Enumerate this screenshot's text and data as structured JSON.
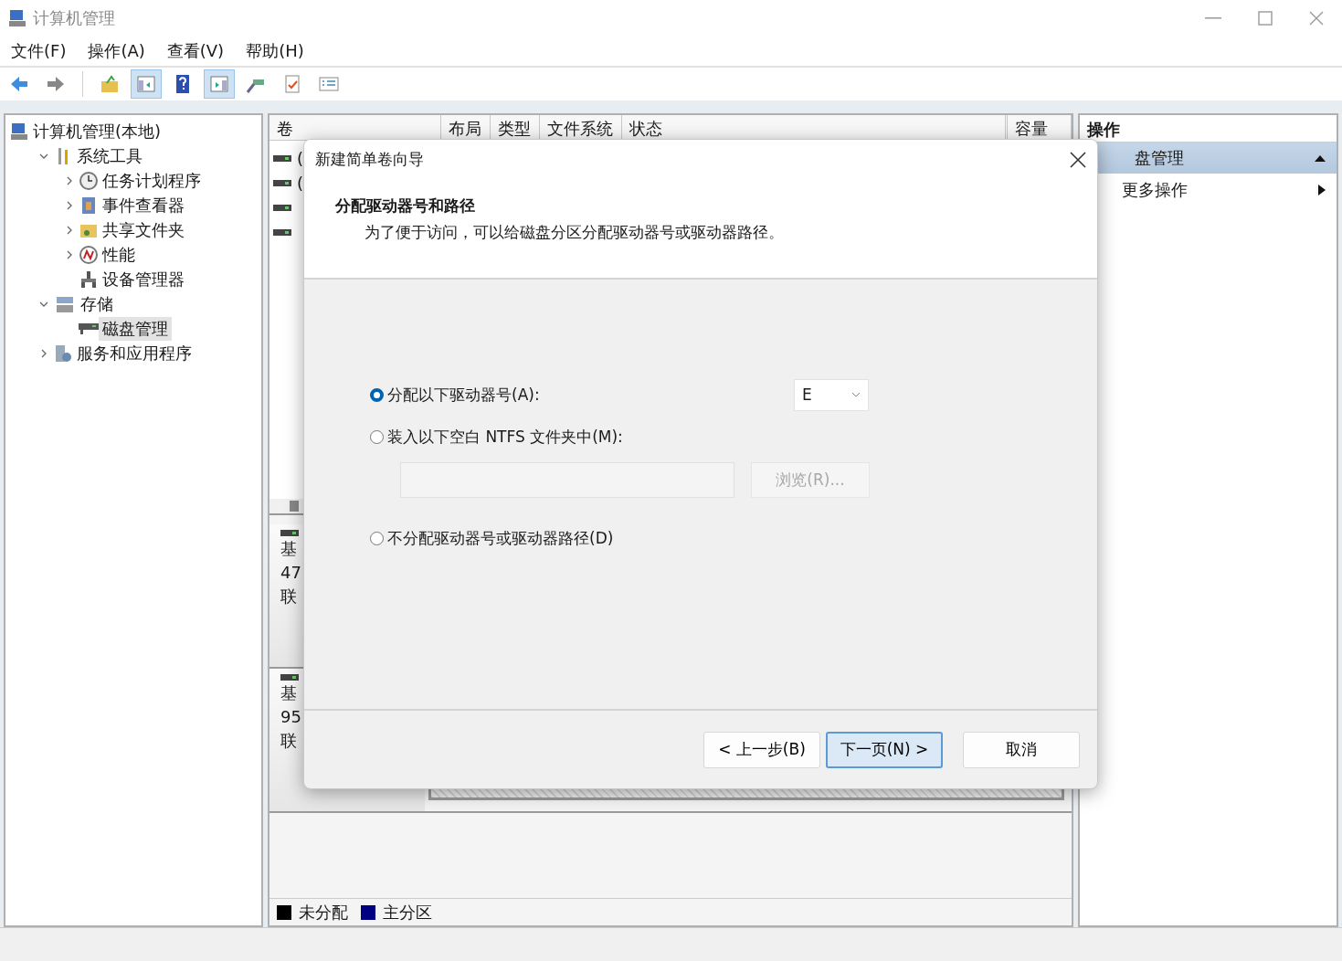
{
  "window": {
    "title": "计算机管理"
  },
  "menu": [
    "文件(F)",
    "操作(A)",
    "查看(V)",
    "帮助(H)"
  ],
  "toolbar": [
    {
      "kind": "back",
      "pressed": false
    },
    {
      "kind": "forward",
      "pressed": false
    },
    {
      "kind": "separator"
    },
    {
      "kind": "up",
      "pressed": false
    },
    {
      "kind": "tree",
      "pressed": true
    },
    {
      "kind": "help",
      "pressed": false
    },
    {
      "kind": "pane",
      "pressed": true
    },
    {
      "kind": "connect",
      "pressed": false
    },
    {
      "kind": "properties",
      "pressed": false
    },
    {
      "kind": "list",
      "pressed": false
    }
  ],
  "tree": {
    "label": "计算机管理(本地)",
    "kind": "computer",
    "selected": false,
    "children": [
      {
        "label": "系统工具",
        "kind": "tools",
        "expanded": true,
        "selected": false,
        "children": [
          {
            "label": "任务计划程序",
            "kind": "clock",
            "expanded": false,
            "selected": false
          },
          {
            "label": "事件查看器",
            "kind": "event",
            "expanded": false,
            "selected": false
          },
          {
            "label": "共享文件夹",
            "kind": "share",
            "expanded": false,
            "selected": false
          },
          {
            "label": "性能",
            "kind": "perf",
            "expanded": false,
            "selected": false
          },
          {
            "label": "设备管理器",
            "kind": "device",
            "selected": false
          }
        ]
      },
      {
        "label": "存储",
        "kind": "storage",
        "expanded": true,
        "selected": false,
        "children": [
          {
            "label": "磁盘管理",
            "kind": "disk",
            "selected": true
          }
        ]
      },
      {
        "label": "服务和应用程序",
        "kind": "services",
        "expanded": false,
        "selected": false
      }
    ]
  },
  "volume_table": {
    "columns": [
      "卷",
      "布局",
      "类型",
      "文件系统",
      "状态",
      "容量"
    ],
    "rows": [
      {
        "kind": "drive",
        "volume": "("
      },
      {
        "kind": "drive",
        "volume": "("
      },
      {
        "kind": "drive"
      },
      {
        "kind": "drive"
      }
    ]
  },
  "disks": [
    {
      "lines": [
        "基",
        "47",
        "联"
      ],
      "kind": "covered"
    },
    {
      "lines": [
        "基",
        "95",
        "联"
      ],
      "kind": "hatched"
    }
  ],
  "legend": [
    {
      "label": "未分配",
      "color": "#000000"
    },
    {
      "label": "主分区",
      "color": "#000080"
    }
  ],
  "actions": {
    "header": "操作",
    "section": "盘管理",
    "items": [
      {
        "label": "更多操作"
      }
    ]
  },
  "dialog": {
    "title": "新建简单卷向导",
    "heading": "分配驱动器号和路径",
    "description": "为了便于访问，可以给磁盘分区分配驱动器号或驱动器路径。",
    "options": [
      {
        "label": "分配以下驱动器号(A):",
        "selected": true
      },
      {
        "label": "装入以下空白 NTFS 文件夹中(M):",
        "selected": false
      },
      {
        "label": "不分配驱动器号或驱动器路径(D)",
        "selected": false
      }
    ],
    "drive_letter": "E",
    "browse": {
      "label": "浏览(R)...",
      "disabled": true
    },
    "buttons": [
      {
        "label": "< 上一步(B)",
        "default": false
      },
      {
        "label": "下一页(N) >",
        "default": true
      },
      {
        "label": "取消",
        "default": false
      }
    ]
  }
}
